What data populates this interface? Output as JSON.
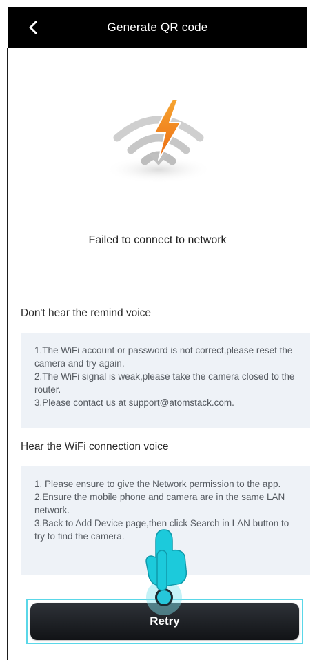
{
  "header": {
    "title": "Generate QR code",
    "back_icon": "chevron-left-icon"
  },
  "status": {
    "hero_icon": "wifi-failed-lightning-icon",
    "message": "Failed to connect to network"
  },
  "sections": [
    {
      "title": "Don't hear the remind voice",
      "lines": [
        "1.The WiFi account or password is not correct,please reset the camera and try again.",
        "2.The WiFi signal is weak,please take the camera closed to the router.",
        "3.Please contact us at support@atomstack.com."
      ]
    },
    {
      "title": "Hear the WiFi connection voice",
      "lines": [
        "1. Please ensure to give the Network permission to the app.",
        "2.Ensure the mobile phone and camera are in the same LAN network.",
        "3.Back to Add Device page,then click Search in LAN button to try to find the camera."
      ]
    }
  ],
  "actions": {
    "retry_label": "Retry"
  },
  "overlay": {
    "pointer_icon": "tap-hand-pointer-icon"
  },
  "colors": {
    "header_bg": "#000000",
    "tips_bg": "#eef2f7",
    "accent_lightning": "#f28a1a",
    "highlight": "#5ad7e8",
    "button_bg": "#1b1e22"
  }
}
